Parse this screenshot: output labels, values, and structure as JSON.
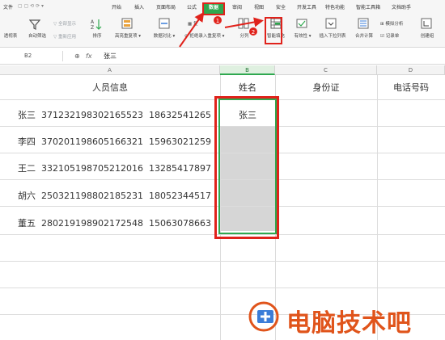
{
  "ribbon_tabs": [
    "文件",
    "开始",
    "插入",
    "页面布局",
    "公式",
    "数据",
    "审阅",
    "视图",
    "安全",
    "开发工具",
    "特色功能",
    "智能工具箱",
    "文档助手"
  ],
  "active_tab": "数据",
  "ribbon": {
    "pivot": "透视表",
    "autofilter": "自动筛选",
    "show_all": "全部显示",
    "reapply": "重新应用",
    "sort": "排序",
    "highlight_dup": "高亮重复项",
    "compare": "数据对比",
    "reject_dup": "拒绝录入重复项",
    "split": "分列",
    "smart_fill": "智能填充",
    "validity": "有效性",
    "dropdown": "插入下拉列表",
    "consolidate": "合并计算",
    "simulate": "模拟分析",
    "record": "记录单",
    "group": "创建组"
  },
  "annotations": [
    "1",
    "2"
  ],
  "formula_bar": {
    "cell_ref": "B2",
    "fx_label": "fx",
    "value": "张三"
  },
  "columns": [
    "A",
    "B",
    "C",
    "D"
  ],
  "header_row": {
    "a": "人员信息",
    "b": "姓名",
    "c": "身份证",
    "d": "电话号码"
  },
  "rows": [
    {
      "name": "张三",
      "id": "371232198302165523",
      "phone": "18632541265"
    },
    {
      "name": "李四",
      "id": "370201198605166321",
      "phone": "15963021259"
    },
    {
      "name": "王二",
      "id": "332105198705212016",
      "phone": "13285417897"
    },
    {
      "name": "胡六",
      "id": "250321198802185231",
      "phone": "18052344517"
    },
    {
      "name": "董五",
      "id": "280219198902172548",
      "phone": "15063078663"
    }
  ],
  "b2_value": "张三",
  "watermark": "电脑技术吧",
  "colors": {
    "accent_green": "#2fa84f",
    "highlight_red": "#e0221b",
    "watermark": "#e0541b"
  }
}
